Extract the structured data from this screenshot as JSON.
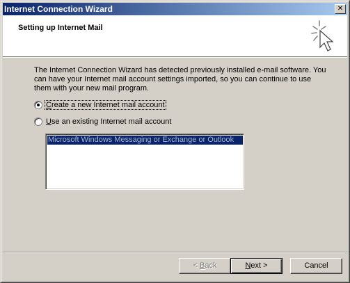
{
  "window": {
    "title": "Internet Connection Wizard",
    "close_glyph": "✕"
  },
  "header": {
    "title": "Setting up Internet Mail",
    "icon": "wizard-wand-cursor-icon"
  },
  "body": {
    "description": "The Internet Connection Wizard has detected previously installed e-mail software. You can have your Internet mail account settings imported, so you can continue to use them with your new mail program.",
    "options": [
      {
        "pre": "",
        "accel": "C",
        "post": "reate a new Internet mail account",
        "selected": true
      },
      {
        "pre": "",
        "accel": "U",
        "post": "se an existing Internet mail account",
        "selected": false
      }
    ],
    "existing_accounts": [
      "Microsoft Windows Messaging or Exchange or Outlook"
    ]
  },
  "buttons": {
    "back": {
      "pre": "< ",
      "accel": "B",
      "post": "ack",
      "enabled": false
    },
    "next": {
      "pre": "",
      "accel": "N",
      "post": "ext >",
      "enabled": true
    },
    "cancel": {
      "label": "Cancel",
      "enabled": true
    }
  }
}
